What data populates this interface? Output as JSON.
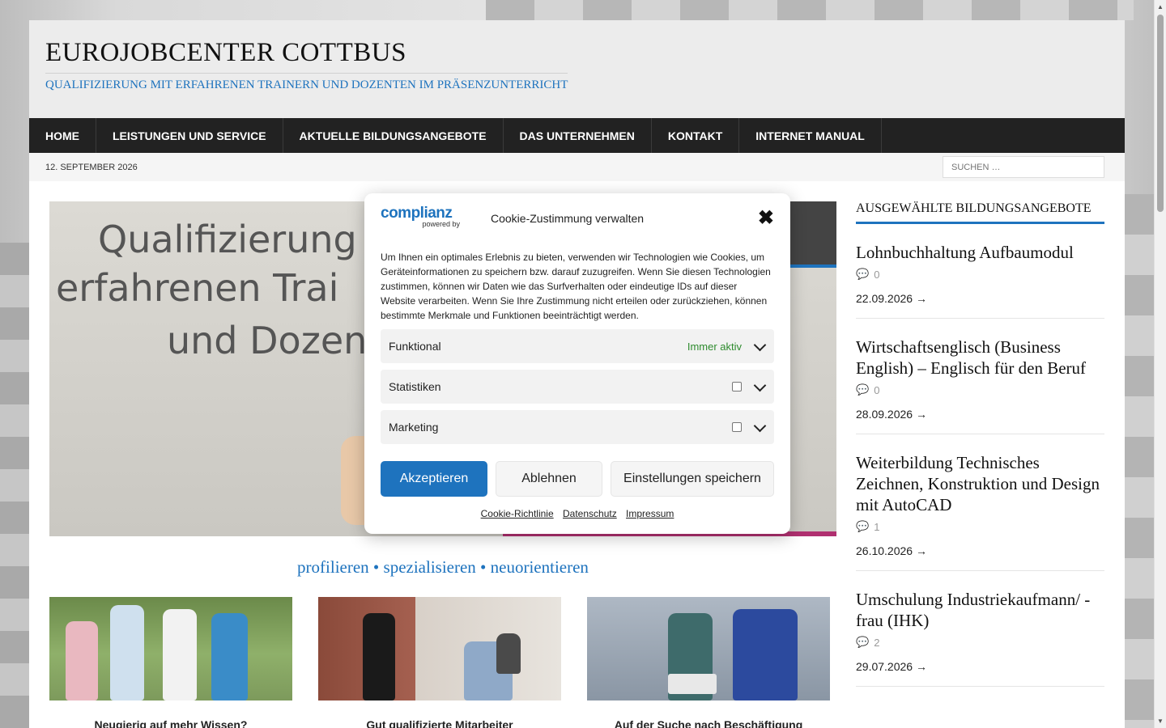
{
  "site": {
    "title": "EUROJOBCENTER COTTBUS",
    "description": "QUALIFIZIERUNG MIT ERFAHRENEN TRAINERN UND DOZENTEN IM PRÄSENZUNTERRICHT"
  },
  "nav": {
    "items": [
      {
        "label": "HOME"
      },
      {
        "label": "LEISTUNGEN UND SERVICE"
      },
      {
        "label": "AKTUELLE BILDUNGSANGEBOTE"
      },
      {
        "label": "DAS UNTERNEHMEN"
      },
      {
        "label": "KONTAKT"
      },
      {
        "label": "INTERNET MANUAL"
      }
    ]
  },
  "subbar": {
    "date": "12. SEPTEMBER 2026",
    "search_placeholder": "SUCHEN …"
  },
  "hero": {
    "line1": "Qualifizierung",
    "line2": "erfahrenen Trai",
    "line3": "und Dozen"
  },
  "tagline": "profilieren • spezialisieren • neuorientieren",
  "cards": [
    {
      "caption": "Neugierig auf mehr Wissen?"
    },
    {
      "caption": "Gut qualifizierte Mitarbeiter"
    },
    {
      "caption": "Auf der Suche nach Beschäftigung"
    }
  ],
  "sidebar": {
    "title": "AUSGEWÄHLTE BILDUNGSANGEBOTE",
    "posts": [
      {
        "title": "Lohnbuchhaltung Aufbaumodul",
        "comments": "0",
        "date": "22.09.2026 →"
      },
      {
        "title": "Wirtschaftsenglisch (Business English) – Englisch für den Beruf",
        "comments": "0",
        "date": "28.09.2026 →"
      },
      {
        "title": "Weiterbildung Technisches Zeichnen, Konstruktion und Design mit AutoCAD",
        "comments": "1",
        "date": "26.10.2026 →"
      },
      {
        "title": "Umschulung Industriekaufmann/ -frau (IHK)",
        "comments": "2",
        "date": "29.07.2026 →"
      }
    ]
  },
  "cookie": {
    "logo": "complianz",
    "logo_sub": "powered by",
    "title": "Cookie-Zustimmung verwalten",
    "close": "✖",
    "text": "Um Ihnen ein optimales Erlebnis zu bieten, verwenden wir Technologien wie Cookies, um Geräteinformationen zu speichern bzw. darauf zuzugreifen. Wenn Sie diesen Technologien zustimmen, können wir Daten wie das Surfverhalten oder eindeutige IDs auf dieser Website verarbeiten. Wenn Sie Ihre Zustimmung nicht erteilen oder zurückziehen, können bestimmte Merkmale und Funktionen beeinträchtigt werden.",
    "categories": [
      {
        "label": "Funktional",
        "status": "Immer aktiv"
      },
      {
        "label": "Statistiken"
      },
      {
        "label": "Marketing"
      }
    ],
    "buttons": {
      "accept": "Akzeptieren",
      "deny": "Ablehnen",
      "save": "Einstellungen speichern"
    },
    "links": [
      "Cookie-Richtlinie",
      "Datenschutz",
      "Impressum"
    ]
  },
  "colors": {
    "accent": "#1e73be",
    "nav_bg": "#222222",
    "always_active": "#2e8b2e"
  }
}
